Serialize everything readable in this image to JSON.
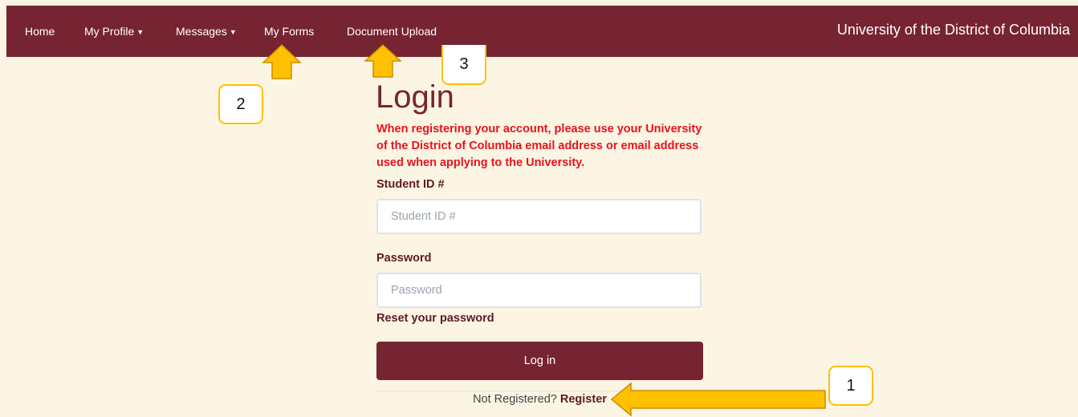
{
  "nav": {
    "items": [
      {
        "label": "Home",
        "dropdown": false
      },
      {
        "label": "My Profile",
        "dropdown": true
      },
      {
        "label": "Messages",
        "dropdown": true
      },
      {
        "label": "My Forms",
        "dropdown": false
      },
      {
        "label": "Document Upload",
        "dropdown": false
      }
    ],
    "brand": "University of the District of Columbia"
  },
  "login": {
    "title": "Login",
    "notice": "When registering your account, please use your University of the District of Columbia email address or email address used when applying to the University.",
    "student_id_label": "Student ID #",
    "student_id_placeholder": "Student ID #",
    "password_label": "Password",
    "password_placeholder": "Password",
    "reset_link": "Reset your password",
    "login_button": "Log in",
    "not_registered": "Not Registered?",
    "register_link": "Register"
  },
  "annotations": [
    {
      "number": "1",
      "icon": "arrow-left-icon"
    },
    {
      "number": "2",
      "icon": "arrow-up-icon"
    },
    {
      "number": "3",
      "icon": "arrow-up-icon"
    }
  ],
  "colors": {
    "brand": "#772432",
    "background": "#fdf5e4",
    "notice": "#e8121e",
    "callout_border": "#ffc000",
    "arrow_fill": "#ffc000",
    "arrow_stroke": "#c89000"
  }
}
